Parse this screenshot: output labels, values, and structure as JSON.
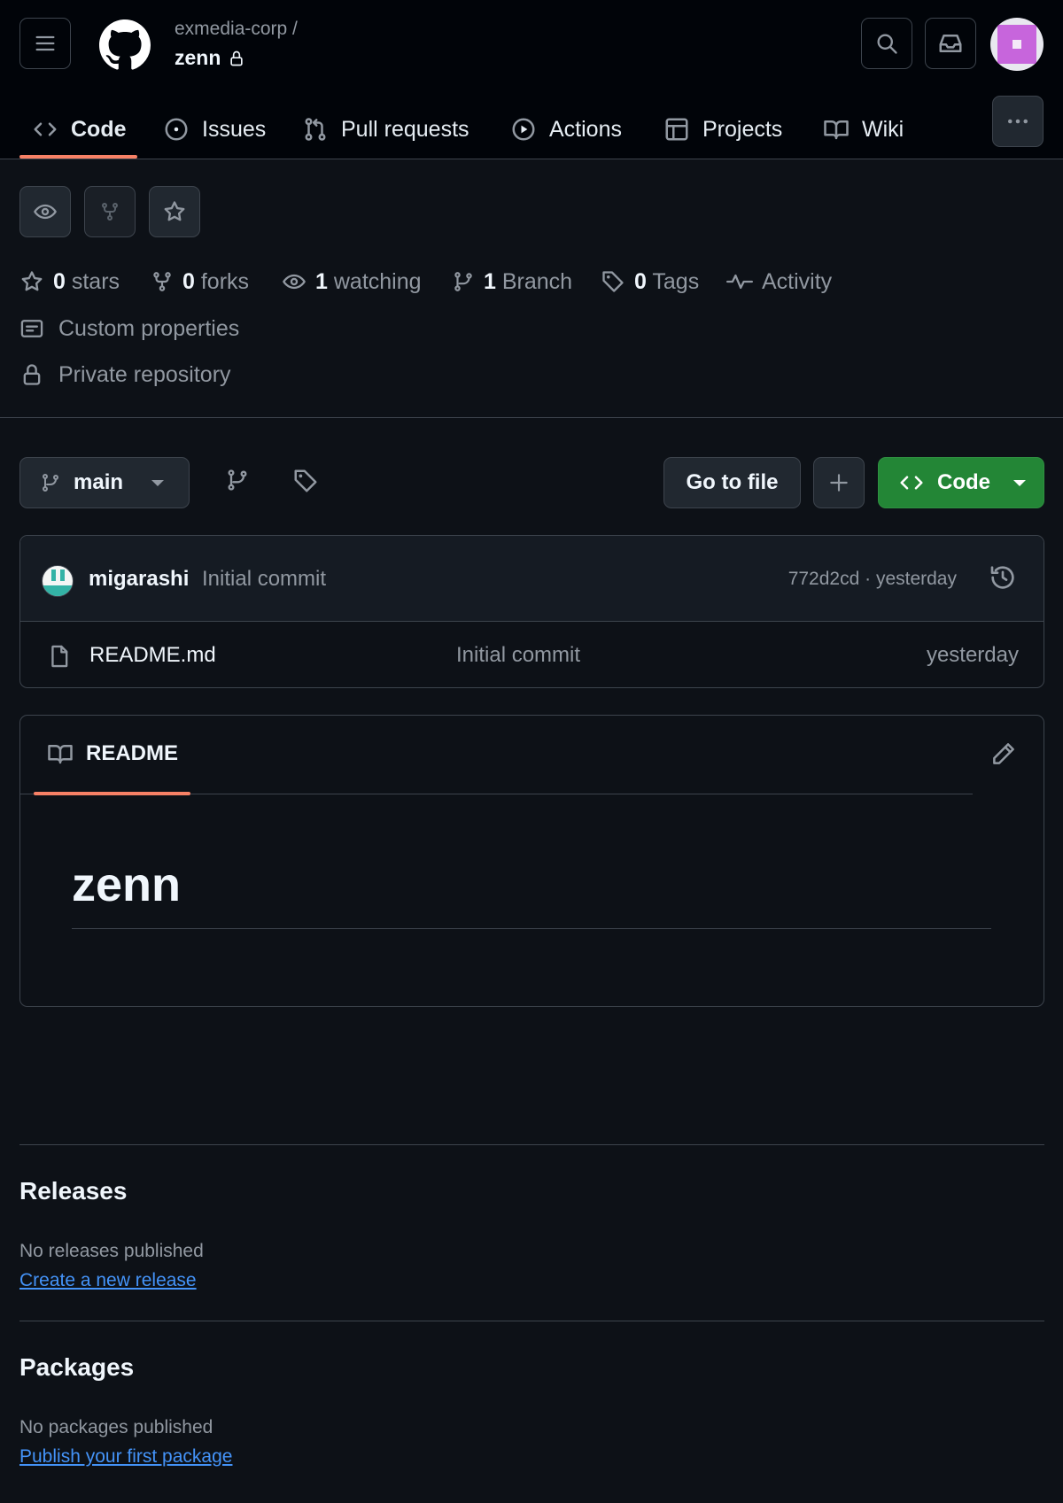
{
  "header": {
    "owner": "exmedia-corp /",
    "repo_name": "zenn"
  },
  "nav": {
    "tabs": [
      {
        "label": "Code",
        "icon": "code-icon",
        "selected": true
      },
      {
        "label": "Issues",
        "icon": "issue-icon"
      },
      {
        "label": "Pull requests",
        "icon": "pull-request-icon"
      },
      {
        "label": "Actions",
        "icon": "play-icon"
      },
      {
        "label": "Projects",
        "icon": "table-icon"
      },
      {
        "label": "Wiki",
        "icon": "book-icon"
      }
    ]
  },
  "stats": {
    "stars_count": "0",
    "stars_label": "stars",
    "forks_count": "0",
    "forks_label": "forks",
    "watching_count": "1",
    "watching_label": "watching",
    "branch_count": "1",
    "branch_label": "Branch",
    "tags_count": "0",
    "tags_label": "Tags",
    "activity_label": "Activity",
    "custom_properties": "Custom properties",
    "visibility": "Private repository"
  },
  "toolbar": {
    "branch": "main",
    "go_to_file": "Go to file",
    "code_button": "Code"
  },
  "commit": {
    "author": "migarashi",
    "message": "Initial commit",
    "meta": "772d2cd · yesterday"
  },
  "files": [
    {
      "name": "README.md",
      "message": "Initial commit",
      "date": "yesterday"
    }
  ],
  "readme": {
    "tab_label": "README",
    "title": "zenn"
  },
  "releases": {
    "title": "Releases",
    "empty_text": "No releases published",
    "link": "Create a new release"
  },
  "packages": {
    "title": "Packages",
    "empty_text": "No packages published",
    "link": "Publish your first package"
  },
  "colors": {
    "background": "#0d1117",
    "header_background": "#010409",
    "accent_underline": "#f78166",
    "code_button": "#238636",
    "link": "#4493f8"
  }
}
